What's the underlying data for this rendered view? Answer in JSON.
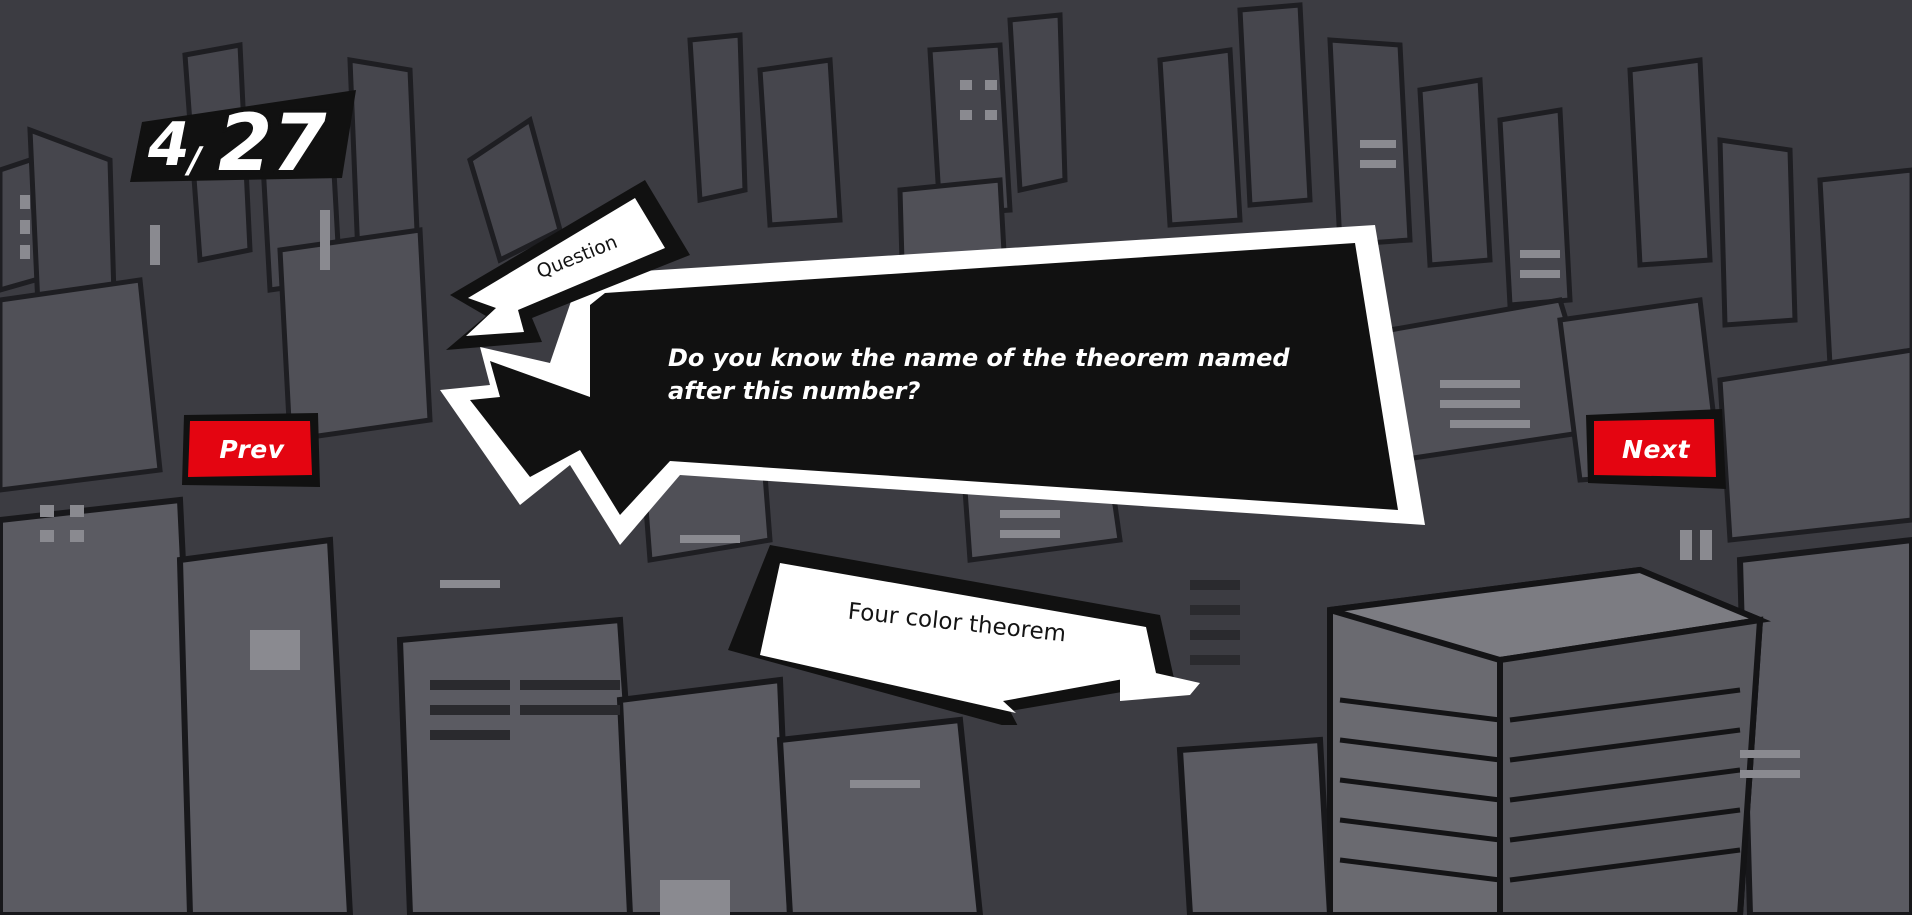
{
  "progress": {
    "current": "4",
    "separator": "/",
    "total": "27"
  },
  "nav": {
    "prev_label": "Prev",
    "next_label": "Next"
  },
  "question": {
    "tag_label": "Question",
    "text": "Do you know the name of the theorem named after this number?"
  },
  "answer": {
    "text": "Four color theorem"
  },
  "colors": {
    "background": "#3c3c42",
    "accent_red": "#e40511",
    "panel_black": "#111111",
    "panel_white": "#ffffff"
  },
  "icons": {
    "background": "city-skyline-illustration",
    "question_tail": "speech-bubble-tail",
    "answer_tail": "ribbon-tail"
  }
}
